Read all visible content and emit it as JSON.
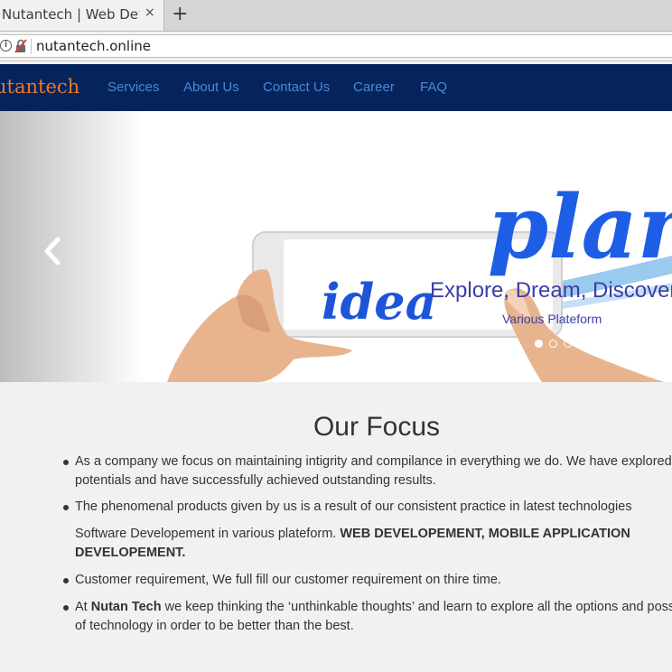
{
  "browser": {
    "tab_title": "Nutantech | Web Deve",
    "tab_close": "×",
    "new_tab": "+",
    "url": "nutantech.online"
  },
  "site": {
    "brand": "utantech",
    "nav": [
      "Services",
      "About Us",
      "Contact Us",
      "Career",
      "FAQ"
    ]
  },
  "carousel": {
    "slide_word_1": "plan",
    "slide_word_2": "idea",
    "caption_title": "Explore, Dream, Discover",
    "caption_sub": "Various Plateform",
    "slide_count": 3,
    "active_slide": 1
  },
  "focus": {
    "title": "Our Focus",
    "p1_line1": "As a company we focus on maintaining intigrity and compilance in everything we do. We have explored o",
    "p1_line2": "potentials and have successfully achieved outstanding results.",
    "p2_line1": "The phenomenal products given by us is a result of our consistent practice in latest technologies",
    "p3_plain": "Software Developement in various plateform. ",
    "p3_bold_1": "WEB DEVELOPEMENT, MOBILE APPLICATION",
    "p3_bold_2": "DEVELOPEMENT.",
    "p4": "Customer requirement, We full fill our customer requirement on thire time.",
    "p5_pre": "At ",
    "p5_bold": "Nutan Tech",
    "p5_post": " we keep thinking the ‘unthinkable thoughts’ and learn to explore all the options and possi",
    "p5_line2": "of technology in order to be better than the best."
  },
  "colors": {
    "header_bg": "#06245c",
    "brand": "#e8782c",
    "nav_link": "#4a88d6",
    "caption": "#3a3fa8"
  }
}
